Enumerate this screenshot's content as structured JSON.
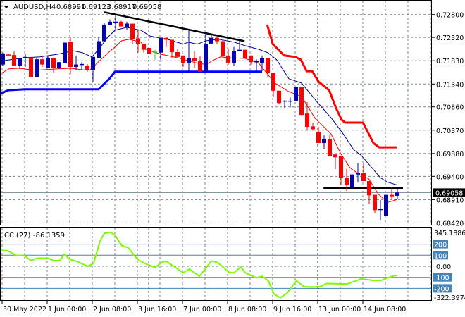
{
  "header": {
    "symbol": "AUDUSD,H4",
    "open": "0.68991",
    "high": "0.69123",
    "low": "0.68917",
    "close": "0.69058"
  },
  "colors": {
    "bull": "#0000b4",
    "bear": "#ff0000",
    "doji": "#32cd32",
    "ma_fast": "#ff0000",
    "ma_slow": "#00008b",
    "support": "#0000ff",
    "resistance": "#ff0000",
    "trend": "#000000",
    "cci": "#7cfc00",
    "grid": "#788592",
    "level": "#4682b4"
  },
  "chart_data": {
    "type": "candlestick",
    "title": "AUDUSD,H4",
    "ylim": [
      0.6842,
      0.728
    ],
    "price_ticks": [
      "0.72800",
      "0.72320",
      "0.71830",
      "0.71340",
      "0.70860",
      "0.70370",
      "0.69880",
      "0.69400",
      "0.68910",
      "0.68420"
    ],
    "current_price": "0.69058",
    "time_labels": [
      {
        "bar": 0,
        "label": "30 May 2022"
      },
      {
        "bar": 8,
        "label": "1 Jun 00:00"
      },
      {
        "bar": 16,
        "label": "2 Jun 08:00"
      },
      {
        "bar": 24,
        "label": "3 Jun 16:00"
      },
      {
        "bar": 32,
        "label": "7 Jun 00:00"
      },
      {
        "bar": 40,
        "label": "8 Jun 08:00"
      },
      {
        "bar": 48,
        "label": "9 Jun 16:00"
      },
      {
        "bar": 56,
        "label": "13 Jun 00:00"
      },
      {
        "bar": 64,
        "label": "14 Jun 08:00"
      }
    ],
    "period_separators": [
      25.9,
      55.9
    ],
    "ohlc": [
      [
        0.7175,
        0.72,
        0.7173,
        0.7197
      ],
      [
        0.7195,
        0.7198,
        0.7192,
        0.7194
      ],
      [
        0.7195,
        0.7203,
        0.7173,
        0.7173
      ],
      [
        0.7173,
        0.7188,
        0.7166,
        0.7188
      ],
      [
        0.7188,
        0.7198,
        0.717,
        0.7191
      ],
      [
        0.7189,
        0.7191,
        0.7149,
        0.7149
      ],
      [
        0.7149,
        0.7189,
        0.7149,
        0.7186
      ],
      [
        0.7186,
        0.7194,
        0.717,
        0.7175
      ],
      [
        0.7167,
        0.7194,
        0.7167,
        0.7188
      ],
      [
        0.7189,
        0.7189,
        0.7158,
        0.7167
      ],
      [
        0.7167,
        0.718,
        0.7166,
        0.718
      ],
      [
        0.7178,
        0.7221,
        0.7178,
        0.7221
      ],
      [
        0.7222,
        0.7232,
        0.7155,
        0.717
      ],
      [
        0.717,
        0.7194,
        0.7164,
        0.7175
      ],
      [
        0.7174,
        0.718,
        0.7163,
        0.7175
      ],
      [
        0.7173,
        0.7176,
        0.716,
        0.7163
      ],
      [
        0.7164,
        0.7191,
        0.7139,
        0.7191
      ],
      [
        0.7189,
        0.7232,
        0.7189,
        0.7224
      ],
      [
        0.7224,
        0.7262,
        0.7224,
        0.7259
      ],
      [
        0.7258,
        0.727,
        0.7258,
        0.7265
      ],
      [
        0.7263,
        0.7279,
        0.7247,
        0.7264
      ],
      [
        0.7265,
        0.7267,
        0.7255,
        0.7255
      ],
      [
        0.7253,
        0.7265,
        0.7247,
        0.7261
      ],
      [
        0.7261,
        0.7261,
        0.7218,
        0.7228
      ],
      [
        0.723,
        0.7247,
        0.72,
        0.7218
      ],
      [
        0.7219,
        0.7219,
        0.72,
        0.7206
      ],
      [
        0.721,
        0.721,
        0.7197,
        0.7198
      ],
      [
        0.7201,
        0.7206,
        0.7185,
        0.7201
      ],
      [
        0.72,
        0.7231,
        0.7185,
        0.7231
      ],
      [
        0.7231,
        0.7231,
        0.7212,
        0.7227
      ],
      [
        0.7227,
        0.7227,
        0.7189,
        0.7201
      ],
      [
        0.7201,
        0.7207,
        0.7191,
        0.7191
      ],
      [
        0.7194,
        0.7194,
        0.717,
        0.7179
      ],
      [
        0.7179,
        0.7247,
        0.7158,
        0.7188
      ],
      [
        0.7189,
        0.7203,
        0.7167,
        0.7182
      ],
      [
        0.7182,
        0.7192,
        0.716,
        0.716
      ],
      [
        0.7161,
        0.7241,
        0.716,
        0.7219
      ],
      [
        0.7219,
        0.7238,
        0.7218,
        0.7231
      ],
      [
        0.7231,
        0.7231,
        0.7218,
        0.7224
      ],
      [
        0.7224,
        0.7227,
        0.7192,
        0.7192
      ],
      [
        0.7194,
        0.7209,
        0.7175,
        0.7179
      ],
      [
        0.7179,
        0.7212,
        0.7173,
        0.7203
      ],
      [
        0.7203,
        0.7225,
        0.7203,
        0.7206
      ],
      [
        0.7206,
        0.7206,
        0.7188,
        0.7188
      ],
      [
        0.7194,
        0.7194,
        0.7175,
        0.718
      ],
      [
        0.718,
        0.7186,
        0.7161,
        0.7181
      ],
      [
        0.7179,
        0.7194,
        0.7161,
        0.7189
      ],
      [
        0.7189,
        0.7189,
        0.7148,
        0.7157
      ],
      [
        0.7157,
        0.7157,
        0.7108,
        0.712
      ],
      [
        0.712,
        0.712,
        0.7093,
        0.7094
      ],
      [
        0.7097,
        0.71,
        0.7084,
        0.7098
      ],
      [
        0.7097,
        0.7106,
        0.7085,
        0.7098
      ],
      [
        0.7099,
        0.7128,
        0.7099,
        0.7128
      ],
      [
        0.7128,
        0.7128,
        0.7069,
        0.7069
      ],
      [
        0.7072,
        0.7096,
        0.7036,
        0.7044
      ],
      [
        0.7045,
        0.7053,
        0.7036,
        0.7039
      ],
      [
        0.7034,
        0.7044,
        0.701,
        0.701
      ],
      [
        0.701,
        0.7026,
        0.6998,
        0.7019
      ],
      [
        0.7019,
        0.7026,
        0.6983,
        0.6983
      ],
      [
        0.6986,
        0.6986,
        0.6955,
        0.698
      ],
      [
        0.6982,
        0.6982,
        0.6922,
        0.6936
      ],
      [
        0.6936,
        0.6956,
        0.6909,
        0.6922
      ],
      [
        0.6916,
        0.6944,
        0.6916,
        0.6944
      ],
      [
        0.6944,
        0.6968,
        0.6927,
        0.6947
      ],
      [
        0.6947,
        0.6968,
        0.693,
        0.693
      ],
      [
        0.693,
        0.693,
        0.6882,
        0.69
      ],
      [
        0.6901,
        0.6901,
        0.6863,
        0.6869
      ],
      [
        0.6869,
        0.689,
        0.6848,
        0.6872
      ],
      [
        0.6857,
        0.6901,
        0.6857,
        0.6901
      ],
      [
        0.6901,
        0.6916,
        0.6893,
        0.6898
      ],
      [
        0.68991,
        0.69123,
        0.68917,
        0.69058
      ]
    ],
    "overlays": [
      {
        "name": "ma-slow",
        "color_key": "ma_slow",
        "width": 1,
        "points": [
          [
            -0.5,
            0.7182
          ],
          [
            3.6,
            0.7189
          ],
          [
            6.6,
            0.7191
          ],
          [
            9.9,
            0.7197
          ],
          [
            12.4,
            0.7204
          ],
          [
            14.1,
            0.72
          ],
          [
            15.8,
            0.7191
          ],
          [
            17,
            0.7207
          ],
          [
            18.6,
            0.7232
          ],
          [
            19.9,
            0.7247
          ],
          [
            22,
            0.7253
          ],
          [
            24.5,
            0.7247
          ],
          [
            26.1,
            0.7235
          ],
          [
            29.5,
            0.7227
          ],
          [
            32,
            0.7218
          ],
          [
            32.9,
            0.7222
          ],
          [
            34.5,
            0.7218
          ],
          [
            36.1,
            0.7225
          ],
          [
            38.3,
            0.7228
          ],
          [
            41.1,
            0.7222
          ],
          [
            42.9,
            0.7215
          ],
          [
            45.4,
            0.7207
          ],
          [
            47,
            0.72
          ],
          [
            48.6,
            0.7185
          ],
          [
            50.75,
            0.7145
          ],
          [
            53,
            0.7136
          ],
          [
            56,
            0.7093
          ],
          [
            58.25,
            0.7063
          ],
          [
            60.4,
            0.7029
          ],
          [
            62.25,
            0.6996
          ],
          [
            63.6,
            0.6984
          ],
          [
            65.4,
            0.6959
          ],
          [
            67,
            0.6937
          ],
          [
            68.25,
            0.6928
          ],
          [
            69.9,
            0.6922
          ]
        ]
      },
      {
        "name": "ma-fast",
        "color_key": "ma_fast",
        "width": 1,
        "points": [
          [
            -0.5,
            0.7155
          ],
          [
            1.1,
            0.7166
          ],
          [
            2.9,
            0.7167
          ],
          [
            5.75,
            0.7163
          ],
          [
            9.9,
            0.7166
          ],
          [
            12,
            0.7167
          ],
          [
            14.1,
            0.7164
          ],
          [
            15.4,
            0.7163
          ],
          [
            17,
            0.7181
          ],
          [
            18.25,
            0.7195
          ],
          [
            19.9,
            0.7212
          ],
          [
            21.1,
            0.7225
          ],
          [
            22.4,
            0.7228
          ],
          [
            24.5,
            0.7222
          ],
          [
            25.4,
            0.7207
          ],
          [
            27.9,
            0.7197
          ],
          [
            31.1,
            0.7189
          ],
          [
            34.5,
            0.7178
          ],
          [
            36.1,
            0.7175
          ],
          [
            37,
            0.7182
          ],
          [
            38.6,
            0.7191
          ],
          [
            40.4,
            0.7189
          ],
          [
            42.9,
            0.7188
          ],
          [
            45.4,
            0.7178
          ],
          [
            48.25,
            0.7136
          ],
          [
            50.75,
            0.7118
          ],
          [
            53,
            0.7108
          ],
          [
            55.4,
            0.7062
          ],
          [
            58.25,
            0.7029
          ],
          [
            59.9,
            0.6989
          ],
          [
            61.6,
            0.6958
          ],
          [
            63.25,
            0.6944
          ],
          [
            64.9,
            0.6935
          ],
          [
            66.6,
            0.6903
          ],
          [
            68.25,
            0.6885
          ],
          [
            69.9,
            0.6891
          ]
        ]
      },
      {
        "name": "support-line",
        "color_key": "support",
        "width": 3,
        "points": [
          [
            -0.5,
            0.7114
          ],
          [
            1,
            0.7121
          ],
          [
            3.9,
            0.7123
          ],
          [
            17,
            0.7123
          ],
          [
            18.9,
            0.7145
          ],
          [
            19.9,
            0.716
          ],
          [
            46,
            0.716
          ]
        ]
      },
      {
        "name": "resistance-line",
        "color_key": "resistance",
        "width": 3,
        "points": [
          [
            46.9,
            0.7259
          ],
          [
            47.9,
            0.7218
          ],
          [
            49.9,
            0.7194
          ],
          [
            51.9,
            0.7191
          ],
          [
            52.9,
            0.7185
          ],
          [
            53.9,
            0.7161
          ],
          [
            54.9,
            0.7161
          ],
          [
            56,
            0.7139
          ],
          [
            57.9,
            0.7121
          ],
          [
            59.1,
            0.7084
          ],
          [
            60.1,
            0.7059
          ],
          [
            60.75,
            0.7053
          ],
          [
            63.9,
            0.7053
          ],
          [
            65.75,
            0.701
          ],
          [
            66.75,
            0.7001
          ],
          [
            69.9,
            0.7001
          ]
        ]
      },
      {
        "name": "trendline-descending",
        "color_key": "trend",
        "width": 2.5,
        "points": [
          [
            18,
            0.7285
          ],
          [
            42.9,
            0.7224
          ]
        ]
      },
      {
        "name": "trendline-horizontal",
        "color_key": "trend",
        "width": 2.5,
        "points": [
          [
            56.9,
            0.6915
          ],
          [
            71,
            0.6915
          ]
        ]
      }
    ],
    "cci": {
      "label": "CCI(27)",
      "value": "-86.1359",
      "ylim": [
        -322.3974,
        345.1886
      ],
      "top_label": "345.1886",
      "bottom_label": "-322.3974",
      "levels": [
        {
          "v": 200,
          "label": "200"
        },
        {
          "v": 100,
          "label": "100"
        },
        {
          "v": -100,
          "label": "-100"
        },
        {
          "v": -200,
          "label": "-200"
        }
      ],
      "zero_label": "0.00",
      "points": [
        [
          -0.5,
          142
        ],
        [
          0.8,
          142
        ],
        [
          2.4,
          98
        ],
        [
          3.75,
          98
        ],
        [
          5,
          52
        ],
        [
          6.1,
          73
        ],
        [
          8,
          73
        ],
        [
          9,
          52
        ],
        [
          10.1,
          52
        ],
        [
          10.9,
          110
        ],
        [
          11.9,
          62
        ],
        [
          13.25,
          42
        ],
        [
          15.1,
          0
        ],
        [
          16.1,
          27
        ],
        [
          17.25,
          229
        ],
        [
          18,
          298
        ],
        [
          19.1,
          308
        ],
        [
          19.9,
          281
        ],
        [
          21.1,
          188
        ],
        [
          22.25,
          167
        ],
        [
          23.9,
          62
        ],
        [
          25.4,
          21
        ],
        [
          27,
          -10
        ],
        [
          28.4,
          42
        ],
        [
          29.1,
          42
        ],
        [
          32,
          -58
        ],
        [
          33.1,
          -25
        ],
        [
          34.9,
          -90
        ],
        [
          37,
          48
        ],
        [
          38.1,
          35
        ],
        [
          40.25,
          -58
        ],
        [
          41,
          -58
        ],
        [
          42.25,
          -6
        ],
        [
          43.1,
          -62
        ],
        [
          45,
          -104
        ],
        [
          46,
          -90
        ],
        [
          47.1,
          -131
        ],
        [
          48.1,
          -250
        ],
        [
          49.25,
          -285
        ],
        [
          50.5,
          -240
        ],
        [
          52.1,
          -131
        ],
        [
          53.4,
          -183
        ],
        [
          54.75,
          -188
        ],
        [
          56.4,
          -183
        ],
        [
          57.4,
          -156
        ],
        [
          61.1,
          -160
        ],
        [
          63.5,
          -115
        ],
        [
          64.5,
          -119
        ],
        [
          65.6,
          -127
        ],
        [
          67.1,
          -127
        ],
        [
          69.5,
          -83
        ],
        [
          70,
          -86.14
        ]
      ]
    }
  }
}
